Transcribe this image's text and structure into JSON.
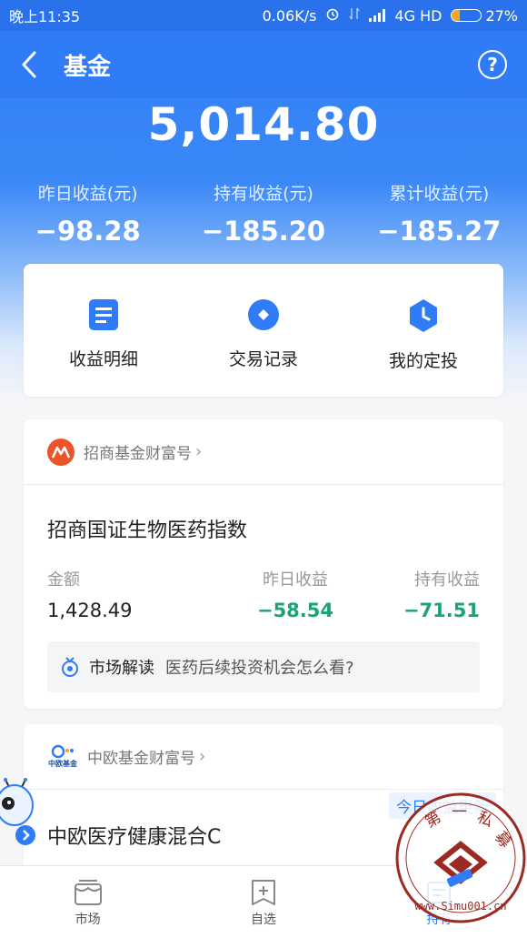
{
  "status_bar": {
    "time": "晚上11:35",
    "net_speed": "0.06K/s",
    "network": "4G HD",
    "battery": "27%",
    "battery_level": 0.27
  },
  "nav": {
    "title": "基金",
    "help_symbol": "?"
  },
  "summary": {
    "total": "5,014.80",
    "metrics": [
      {
        "label": "昨日收益(元)",
        "value": "−98.28"
      },
      {
        "label": "持有收益(元)",
        "value": "−185.20"
      },
      {
        "label": "累计收益(元)",
        "value": "−185.27"
      }
    ]
  },
  "quick_actions": [
    {
      "label": "收益明细",
      "icon": "document-icon"
    },
    {
      "label": "交易记录",
      "icon": "diamond-circle-icon"
    },
    {
      "label": "我的定投",
      "icon": "clock-icon"
    }
  ],
  "fund1": {
    "brand": "招商基金财富号",
    "chevron": "›",
    "name": "招商国证生物医药指数",
    "cols": [
      {
        "label": "金额",
        "value": "1,428.49"
      },
      {
        "label": "昨日收益",
        "value": "−58.54"
      },
      {
        "label": "持有收益",
        "value": "−71.51"
      }
    ],
    "insight_tag": "市场解读",
    "insight_text": "医药后续投资机会怎么看?"
  },
  "fund2": {
    "brand": "中欧基金财富号",
    "logo_text": "中欧基金",
    "chevron": "›",
    "badge": "今日收益更新",
    "name": "中欧医疗健康混合C"
  },
  "tabs": [
    {
      "label": "市场",
      "icon": "market-icon"
    },
    {
      "label": "自选",
      "icon": "add-favorite-icon"
    },
    {
      "label": "持有",
      "icon": "holding-icon"
    }
  ],
  "watermark": {
    "text": "第一私募 www.Simu001.cn"
  },
  "colors": {
    "primary": "#2f7cf6",
    "negative": "#1aa37a",
    "brand_orange": "#e8562a"
  }
}
